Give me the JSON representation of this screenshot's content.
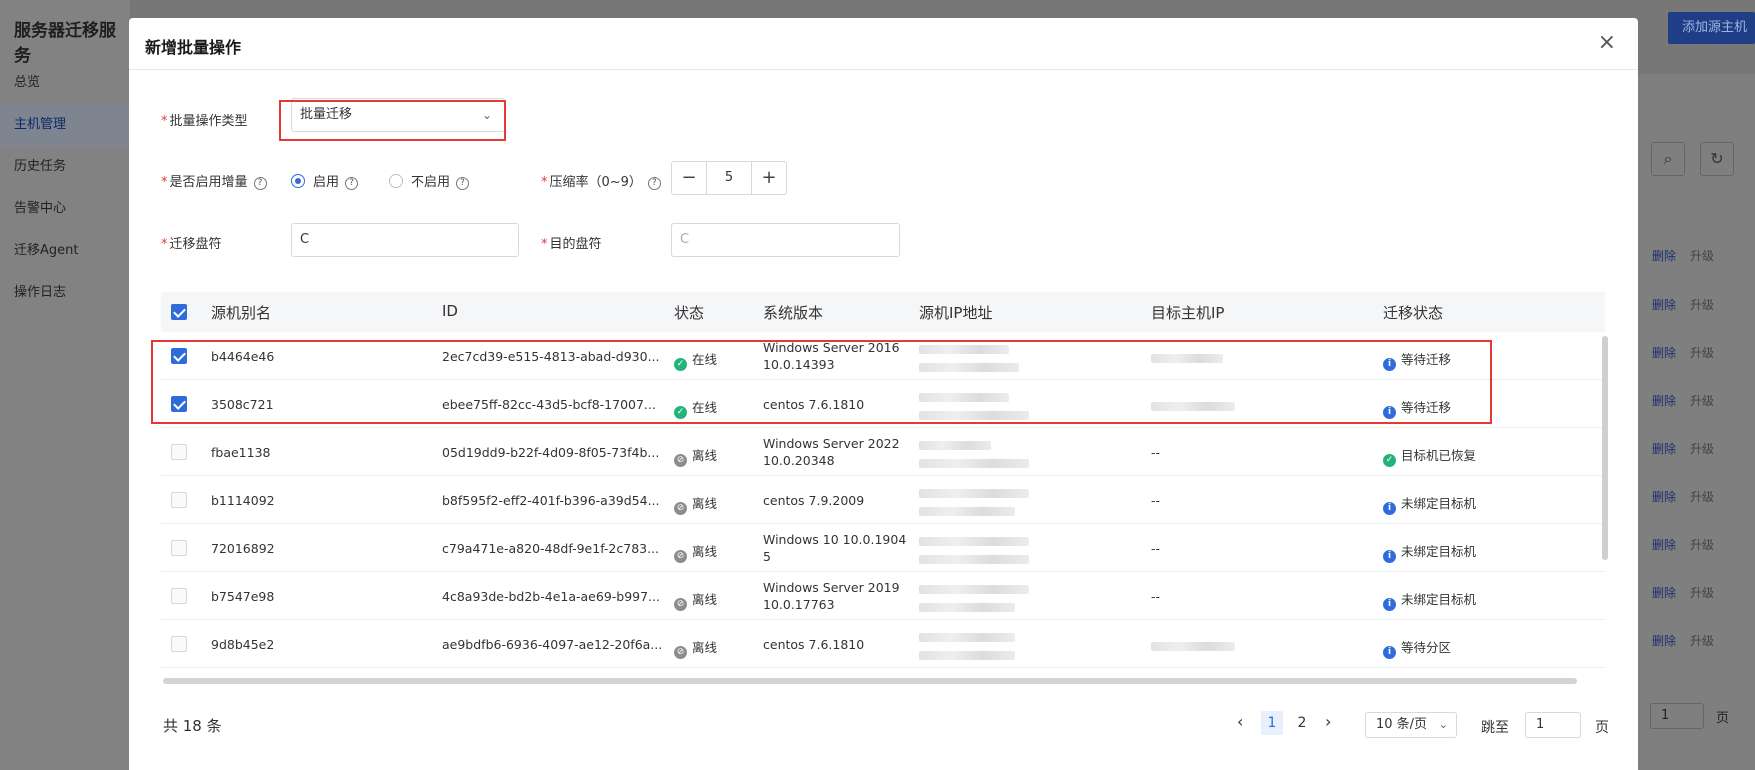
{
  "app": {
    "title": "服务器迁移服务",
    "add_button": "添加源主机",
    "nav": [
      {
        "label": "总览",
        "active": false
      },
      {
        "label": "主机管理",
        "active": true
      },
      {
        "label": "历史任务",
        "active": false
      },
      {
        "label": "告警中心",
        "active": false
      },
      {
        "label": "迁移Agent",
        "active": false
      },
      {
        "label": "操作日志",
        "active": false
      }
    ],
    "row_delete": "删除",
    "row_upgrade": "升级",
    "page_input": "1",
    "page_unit": "页"
  },
  "modal": {
    "title": "新增批量操作",
    "close_icon": "×",
    "form": {
      "type_label": "批量操作类型",
      "type_value": "批量迁移",
      "incremental_label": "是否启用增量",
      "incremental_options": [
        "启用",
        "不启用"
      ],
      "incremental_selected": "启用",
      "compression_label": "压缩率（0~9）",
      "compression_value": "5",
      "source_drive_label": "迁移盘符",
      "source_drive_value": "C",
      "target_drive_label": "目的盘符",
      "target_drive_placeholder": "C"
    },
    "table": {
      "headers": [
        "源机别名",
        "ID",
        "状态",
        "系统版本",
        "源机IP地址",
        "目标主机IP",
        "迁移状态"
      ],
      "rows": [
        {
          "checked": true,
          "alias": "b4464e46",
          "id": "2ec7cd39-e515-4813-abad-d930...",
          "status": "在线",
          "online": true,
          "os": [
            "Windows Server 2016",
            "10.0.14393"
          ],
          "target": "blur",
          "migration": "等待迁移",
          "mig_type": "info"
        },
        {
          "checked": true,
          "alias": "3508c721",
          "id": "ebee75ff-82cc-43d5-bcf8-17007...",
          "status": "在线",
          "online": true,
          "os": [
            "centos 7.6.1810"
          ],
          "target": "blur",
          "migration": "等待迁移",
          "mig_type": "info"
        },
        {
          "checked": false,
          "alias": "fbae1138",
          "id": "05d19dd9-b22f-4d09-8f05-73f4b...",
          "status": "离线",
          "online": false,
          "os": [
            "Windows Server 2022",
            "10.0.20348"
          ],
          "target": "--",
          "migration": "目标机已恢复",
          "mig_type": "ok"
        },
        {
          "checked": false,
          "alias": "b1114092",
          "id": "b8f595f2-eff2-401f-b396-a39d54...",
          "status": "离线",
          "online": false,
          "os": [
            "centos 7.9.2009"
          ],
          "target": "--",
          "migration": "未绑定目标机",
          "mig_type": "info"
        },
        {
          "checked": false,
          "alias": "72016892",
          "id": "c79a471e-a820-48df-9e1f-2c783...",
          "status": "离线",
          "online": false,
          "os": [
            "Windows 10 10.0.1904",
            "5"
          ],
          "target": "--",
          "migration": "未绑定目标机",
          "mig_type": "info"
        },
        {
          "checked": false,
          "alias": "b7547e98",
          "id": "4c8a93de-bd2b-4e1a-ae69-b997...",
          "status": "离线",
          "online": false,
          "os": [
            "Windows Server 2019",
            "10.0.17763"
          ],
          "target": "--",
          "migration": "未绑定目标机",
          "mig_type": "info"
        },
        {
          "checked": false,
          "alias": "9d8b45e2",
          "id": "ae9bdfb6-6936-4097-ae12-20f6a...",
          "status": "离线",
          "online": false,
          "os": [
            "centos 7.6.1810"
          ],
          "target": "blur",
          "migration": "等待分区",
          "mig_type": "info"
        }
      ]
    },
    "footer": {
      "total": "共 18 条",
      "pages": [
        "1",
        "2"
      ],
      "current_page": "1",
      "page_size": "10 条/页",
      "jump_label": "跳至",
      "jump_value": "1",
      "jump_unit": "页"
    }
  }
}
